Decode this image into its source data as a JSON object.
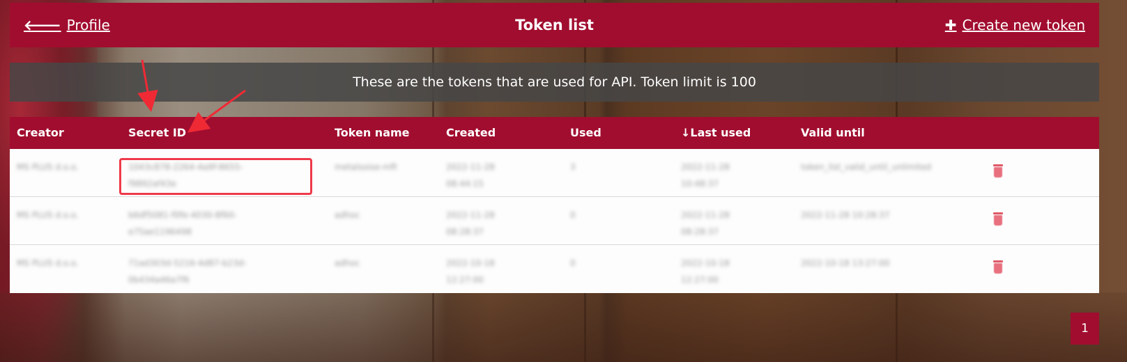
{
  "header": {
    "back_label": "Profile",
    "title": "Token list",
    "create_label": "Create new token"
  },
  "notice": "These are the tokens that are used for API. Token limit is 100",
  "table": {
    "columns": [
      "Creator",
      "Secret ID",
      "Token name",
      "Created",
      "Used",
      "↓Last used",
      "Valid until"
    ],
    "rows": [
      {
        "creator": "MS PLUS d.o.o.",
        "secret_id": [
          "1043c878-2264-4a9f-8655-",
          "f9892af43e"
        ],
        "token_name": "metalsoise-mft",
        "created": [
          "2022-11-28",
          "08:44:15"
        ],
        "used": "3",
        "last_used": [
          "2022-11-28",
          "10:48:37"
        ],
        "valid_until": "token_list_valid_until_unlimited"
      },
      {
        "creator": "MS PLUS d.o.o.",
        "secret_id": [
          "b6df5081-f0fe-4030-8f60-",
          "e75ae1196498"
        ],
        "token_name": "adhoc",
        "created": [
          "2022-11-28",
          "08:28:37"
        ],
        "used": "0",
        "last_used": [
          "2022-11-28",
          "08:28:37"
        ],
        "valid_until": "2022-11-28 10:28:37"
      },
      {
        "creator": "MS PLUS d.o.o.",
        "secret_id": [
          "71ad303d-5216-4d87-b23d-",
          "0b434a46a7f6"
        ],
        "token_name": "adhoc",
        "created": [
          "2022-10-18",
          "12:27:00"
        ],
        "used": "0",
        "last_used": [
          "2022-10-18",
          "12:27:00"
        ],
        "valid_until": "2022-10-18 13:27:00"
      }
    ]
  },
  "pagination": {
    "current": "1"
  },
  "colors": {
    "brand": "#a10d2f",
    "notice_bg": "#464646",
    "annotation": "#ef3a4a"
  },
  "icons": {
    "back": "arrow-left-icon",
    "create": "plus-icon",
    "delete": "trash-icon"
  }
}
